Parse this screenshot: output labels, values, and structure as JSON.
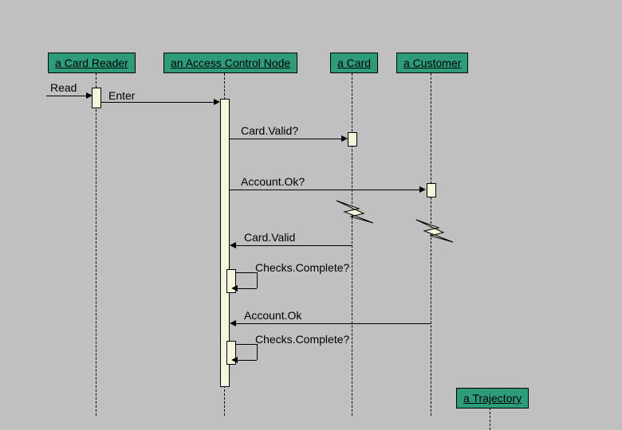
{
  "participants": {
    "card_reader": "a Card Reader",
    "access_control": "an Access Control Node",
    "card": "a Card",
    "customer": "a Customer",
    "trajectory": "a Trajectory"
  },
  "messages": {
    "read": "Read",
    "enter": "Enter",
    "card_valid_q": "Card.Valid?",
    "account_ok_q": "Account.Ok?",
    "card_valid": "Card.Valid",
    "checks_complete_q1": "Checks.Complete?",
    "account_ok": "Account.Ok",
    "checks_complete_q2": "Checks.Complete?"
  }
}
